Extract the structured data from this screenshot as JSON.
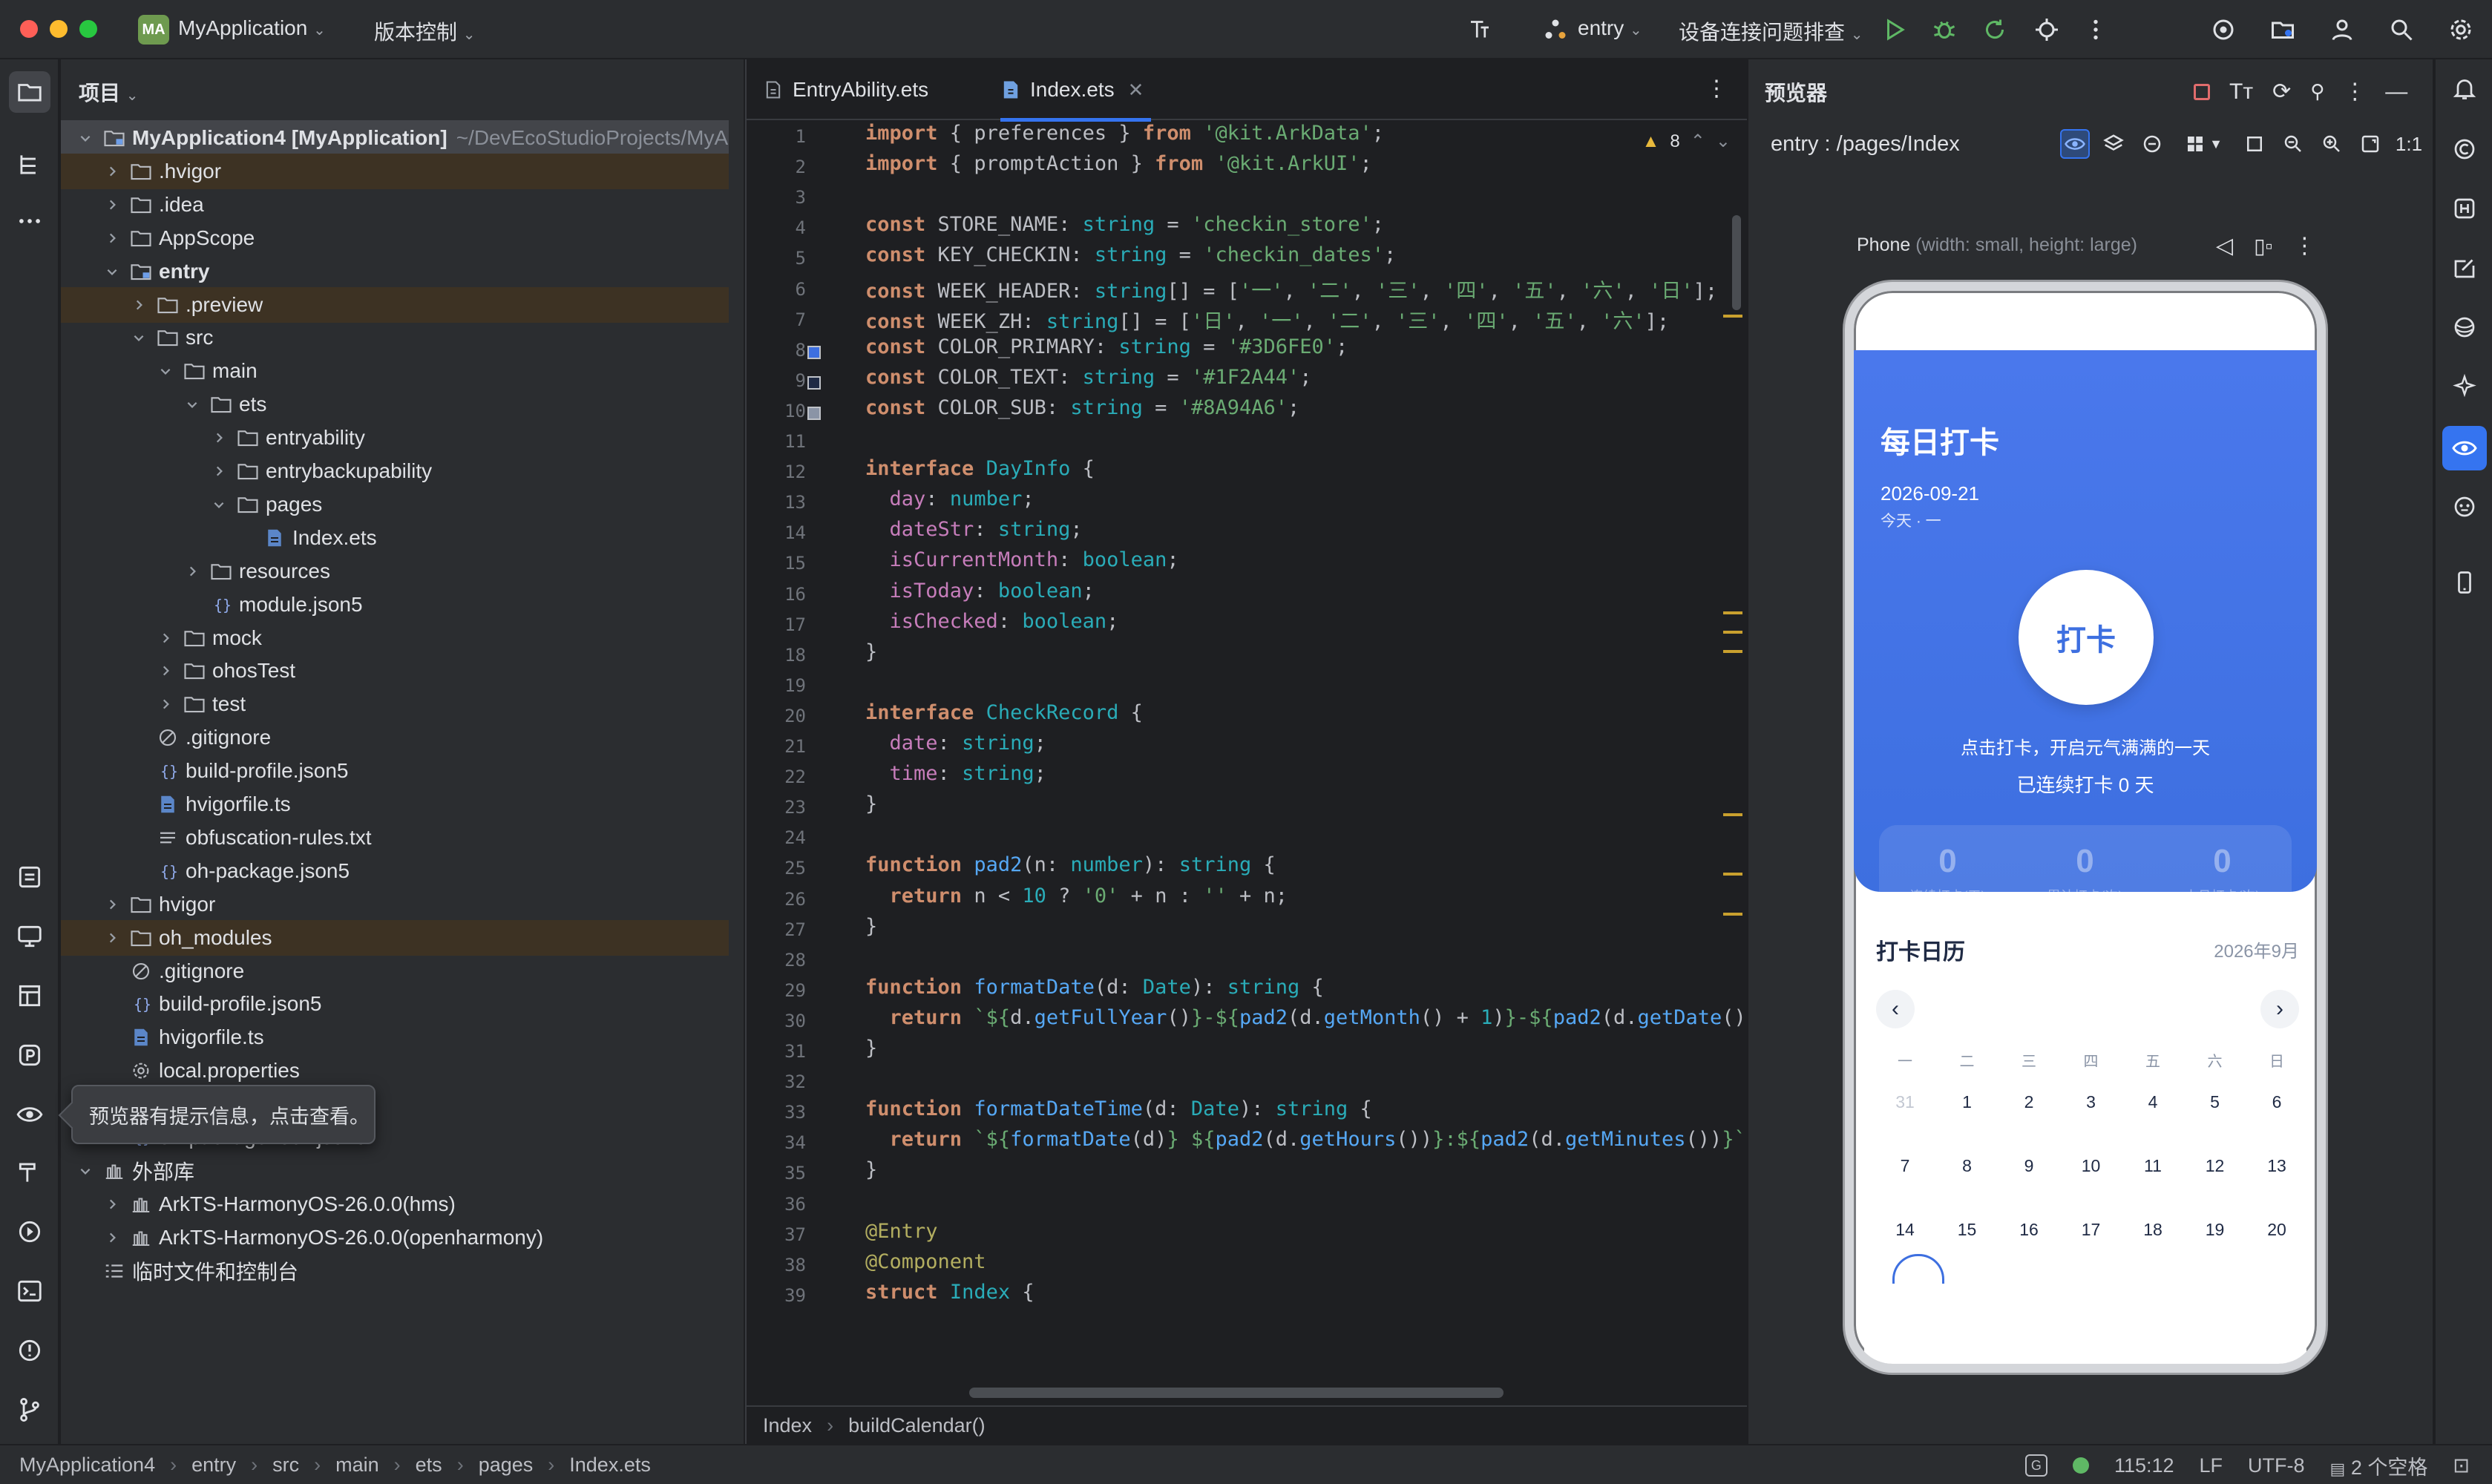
{
  "titlebar": {
    "project_badge": "MA",
    "project_name": "MyApplication",
    "vcs_label": "版本控制",
    "run_config": "entry",
    "device_label": "设备连接问题排查"
  },
  "project_panel": {
    "title": "项目",
    "tree": [
      {
        "label": "MyApplication4 [MyApplication]",
        "sub": "~/DevEcoStudioProjects/MyA",
        "icon": "module-icon",
        "bold": true,
        "state": "selected"
      },
      {
        "label": ".hvigor",
        "icon": "folder-icon",
        "state": "excluded"
      },
      {
        "label": ".idea",
        "icon": "folder-icon"
      },
      {
        "label": "AppScope",
        "icon": "folder-icon"
      },
      {
        "label": "entry",
        "icon": "module-icon",
        "bold": true
      },
      {
        "label": ".preview",
        "icon": "folder-icon",
        "state": "excluded"
      },
      {
        "label": "src",
        "icon": "folder-icon"
      },
      {
        "label": "main",
        "icon": "folder-icon"
      },
      {
        "label": "ets",
        "icon": "folder-icon"
      },
      {
        "label": "entryability",
        "icon": "folder-icon"
      },
      {
        "label": "entrybackupability",
        "icon": "folder-icon"
      },
      {
        "label": "pages",
        "icon": "folder-icon"
      },
      {
        "label": "Index.ets",
        "icon": "ets-file-icon"
      },
      {
        "label": "resources",
        "icon": "folder-icon"
      },
      {
        "label": "module.json5",
        "icon": "json-file-icon"
      },
      {
        "label": "mock",
        "icon": "folder-icon"
      },
      {
        "label": "ohosTest",
        "icon": "folder-icon"
      },
      {
        "label": "test",
        "icon": "folder-icon"
      },
      {
        "label": ".gitignore",
        "icon": "ignore-file-icon"
      },
      {
        "label": "build-profile.json5",
        "icon": "json-file-icon"
      },
      {
        "label": "hvigorfile.ts",
        "icon": "ets-file-icon"
      },
      {
        "label": "obfuscation-rules.txt",
        "icon": "text-file-icon"
      },
      {
        "label": "oh-package.json5",
        "icon": "json-file-icon"
      },
      {
        "label": "hvigor",
        "icon": "folder-icon"
      },
      {
        "label": "oh_modules",
        "icon": "folder-icon",
        "state": "excluded"
      },
      {
        "label": ".gitignore",
        "icon": "ignore-file-icon"
      },
      {
        "label": "build-profile.json5",
        "icon": "json-file-icon"
      },
      {
        "label": "hvigorfile.ts",
        "icon": "ets-file-icon"
      },
      {
        "label": "local.properties",
        "icon": "settings-file-icon"
      },
      {
        "label": "oh-package.json5",
        "icon": "json-file-icon"
      },
      {
        "label": "oh-package-lock.json5",
        "icon": "json-file-icon"
      },
      {
        "label": "外部库",
        "icon": "library-icon"
      },
      {
        "label": "ArkTS-HarmonyOS-26.0.0(hms)",
        "icon": "library-icon"
      },
      {
        "label": "ArkTS-HarmonyOS-26.0.0(openharmony)",
        "icon": "library-icon"
      },
      {
        "label": "临时文件和控制台",
        "icon": "scratches-icon"
      }
    ],
    "tooltip": "预览器有提示信息，点击查看。"
  },
  "editor": {
    "tabs": [
      {
        "label": "EntryAbility.ets",
        "active": false
      },
      {
        "label": "Index.ets",
        "active": true
      }
    ],
    "warning_count": "8",
    "breadcrumb": [
      "Index",
      "buildCalendar()"
    ],
    "swatch_colors": [
      "#3D6FE0",
      "#1F2A44",
      "#8A94A6"
    ]
  },
  "previewer": {
    "title": "预览器",
    "page_path": "entry : /pages/Index",
    "device_name": "Phone",
    "device_desc": "(width: small, height: large)",
    "zoom_label": "1:1",
    "app": {
      "title": "每日打卡",
      "date": "2026-09-21",
      "subtitle": "今天 · 一",
      "checkin_button": "打卡",
      "hint": "点击打卡，开启元气满满的一天",
      "streak": "已连续打卡 0 天",
      "stats": [
        {
          "value": "0",
          "label": "连续打卡(天)"
        },
        {
          "value": "0",
          "label": "累计打卡(次)"
        },
        {
          "value": "0",
          "label": "本月打卡(次)"
        }
      ],
      "calendar_title": "打卡日历",
      "calendar_month": "2026年9月",
      "prev_label": "‹",
      "next_label": "›",
      "weekdays": [
        "一",
        "二",
        "三",
        "四",
        "五",
        "六",
        "日"
      ],
      "days": [
        [
          "31",
          "1",
          "2",
          "3",
          "4",
          "5",
          "6"
        ],
        [
          "7",
          "8",
          "9",
          "10",
          "11",
          "12",
          "13"
        ],
        [
          "14",
          "15",
          "16",
          "17",
          "18",
          "19",
          "20"
        ]
      ]
    }
  },
  "statusbar": {
    "breadcrumb": [
      "MyApplication4",
      "entry",
      "src",
      "main",
      "ets",
      "pages",
      "Index.ets"
    ],
    "position": "115:12",
    "line_ending": "LF",
    "encoding": "UTF-8",
    "indent": "2 个空格"
  },
  "colors": {
    "accent": "#3574f0",
    "app_primary": "#3d6fe0",
    "app_text": "#1f2a44",
    "app_sub": "#8a94a6"
  }
}
